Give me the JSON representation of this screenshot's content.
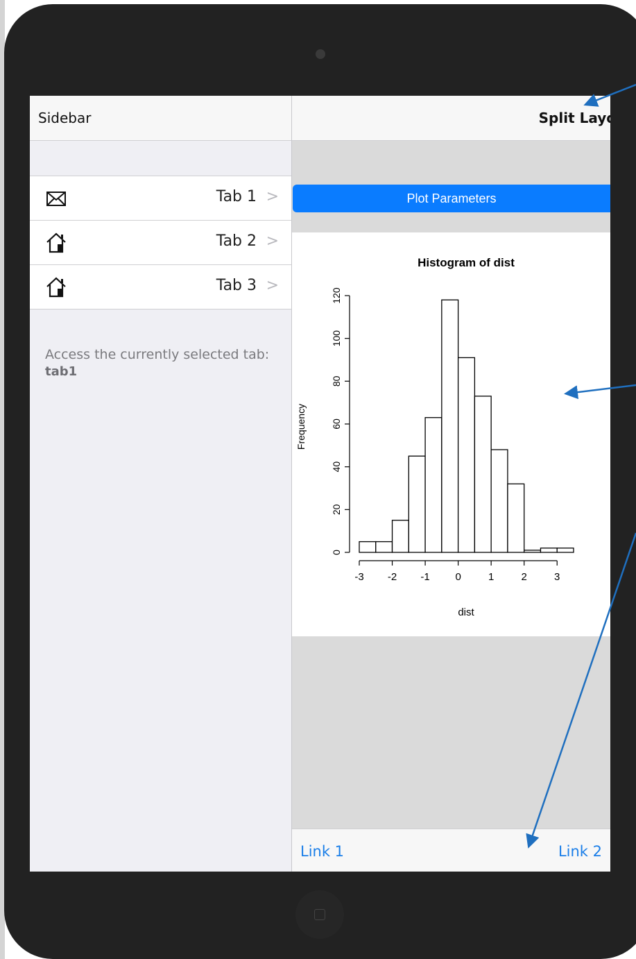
{
  "sidebar": {
    "title": "Sidebar",
    "items": [
      {
        "label": "Tab 1",
        "icon": "envelope-icon"
      },
      {
        "label": "Tab 2",
        "icon": "home-icon"
      },
      {
        "label": "Tab 3",
        "icon": "home-icon"
      }
    ],
    "chevron": ">",
    "selected_text": "Access the currently selected tab:",
    "selected_value": "tab1"
  },
  "main": {
    "title": "Split Layo",
    "button_label": "Plot Parameters",
    "links": [
      "Link 1",
      "Link 2"
    ]
  },
  "colors": {
    "accent": "#0a7cff",
    "link": "#1a7ee8",
    "annotation_arrow": "#1f6fbf",
    "device": "#222222"
  },
  "chart_data": {
    "type": "bar",
    "title": "Histogram of dist",
    "xlabel": "dist",
    "ylabel": "Frequency",
    "bins": [
      -3.0,
      -2.5,
      -2.0,
      -1.5,
      -1.0,
      -0.5,
      0.0,
      0.5,
      1.0,
      1.5,
      2.0,
      2.5,
      3.0,
      3.5
    ],
    "values": [
      5,
      5,
      15,
      45,
      63,
      118,
      91,
      73,
      48,
      32,
      1,
      2,
      2
    ],
    "xticks": [
      -3,
      -2,
      -1,
      0,
      1,
      2,
      3
    ],
    "yticks": [
      0,
      20,
      40,
      60,
      80,
      100,
      120
    ],
    "xlim": [
      -3,
      3.5
    ],
    "ylim": [
      0,
      120
    ],
    "grid": false
  }
}
